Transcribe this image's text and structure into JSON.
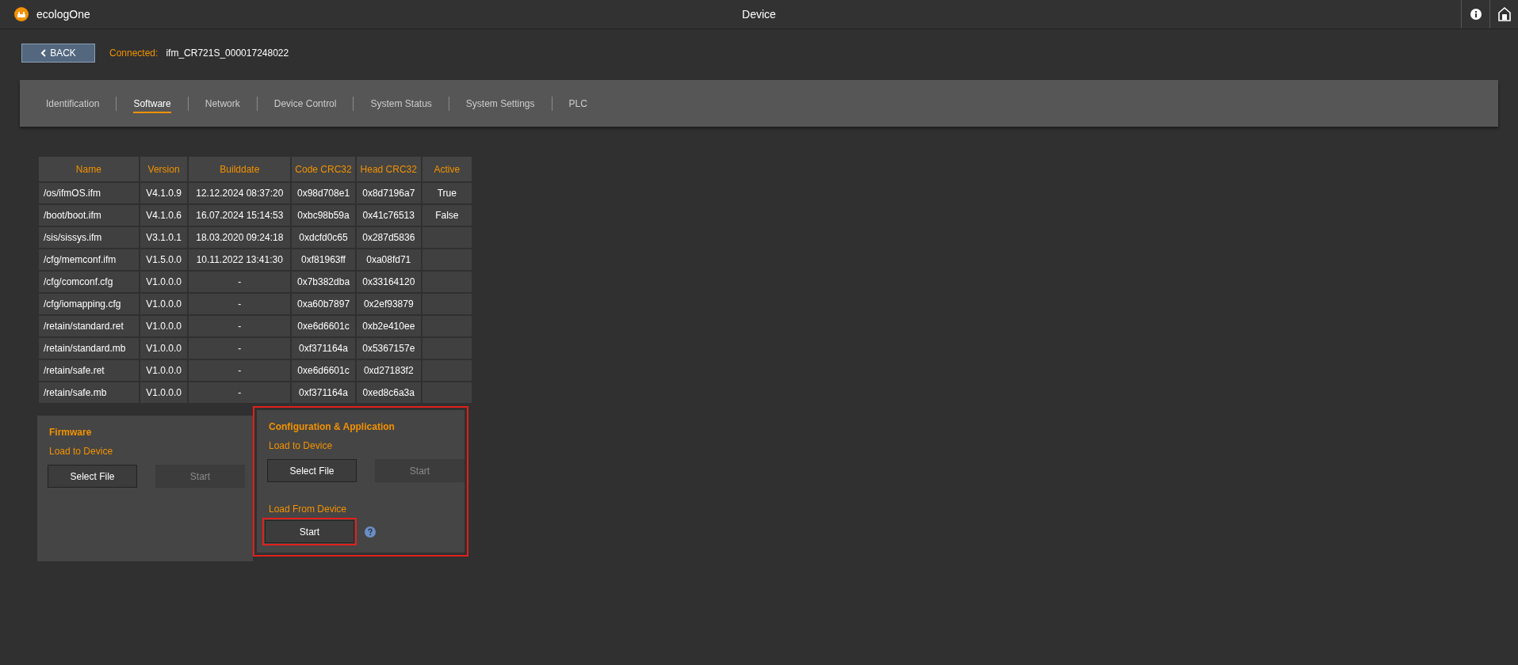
{
  "app": {
    "name": "ecologOne",
    "title": "Device"
  },
  "connection": {
    "back": "BACK",
    "label": "Connected:",
    "device": "ifm_CR721S_000017248022"
  },
  "tabs": [
    {
      "label": "Identification",
      "selected": false
    },
    {
      "label": "Software",
      "selected": true
    },
    {
      "label": "Network",
      "selected": false
    },
    {
      "label": "Device Control",
      "selected": false
    },
    {
      "label": "System Status",
      "selected": false
    },
    {
      "label": "System Settings",
      "selected": false
    },
    {
      "label": "PLC",
      "selected": false
    }
  ],
  "table": {
    "columns": [
      "Name",
      "Version",
      "Builddate",
      "Code CRC32",
      "Head CRC32",
      "Active"
    ],
    "rows": [
      [
        "/os/ifmOS.ifm",
        "V4.1.0.9",
        "12.12.2024 08:37:20",
        "0x98d708e1",
        "0x8d7196a7",
        "True"
      ],
      [
        "/boot/boot.ifm",
        "V4.1.0.6",
        "16.07.2024 15:14:53",
        "0xbc98b59a",
        "0x41c76513",
        "False"
      ],
      [
        "/sis/sissys.ifm",
        "V3.1.0.1",
        "18.03.2020 09:24:18",
        "0xdcfd0c65",
        "0x287d5836",
        ""
      ],
      [
        "/cfg/memconf.ifm",
        "V1.5.0.0",
        "10.11.2022 13:41:30",
        "0xf81963ff",
        "0xa08fd71",
        ""
      ],
      [
        "/cfg/comconf.cfg",
        "V1.0.0.0",
        "-",
        "0x7b382dba",
        "0x33164120",
        ""
      ],
      [
        "/cfg/iomapping.cfg",
        "V1.0.0.0",
        "-",
        "0xa60b7897",
        "0x2ef93879",
        ""
      ],
      [
        "/retain/standard.ret",
        "V1.0.0.0",
        "-",
        "0xe6d6601c",
        "0xb2e410ee",
        ""
      ],
      [
        "/retain/standard.mb",
        "V1.0.0.0",
        "-",
        "0xf371164a",
        "0x5367157e",
        ""
      ],
      [
        "/retain/safe.ret",
        "V1.0.0.0",
        "-",
        "0xe6d6601c",
        "0xd27183f2",
        ""
      ],
      [
        "/retain/safe.mb",
        "V1.0.0.0",
        "-",
        "0xf371164a",
        "0xed8c6a3a",
        ""
      ]
    ]
  },
  "sections": [
    {
      "title": "Firmware",
      "highlighted": false,
      "groups": [
        {
          "label": "Load to Device",
          "buttons": [
            {
              "label": "Select File",
              "disabled": false,
              "highlighted": false,
              "help": false
            },
            {
              "label": "Start",
              "disabled": true,
              "highlighted": false,
              "help": false
            }
          ]
        }
      ]
    },
    {
      "title": "Configuration & Application",
      "highlighted": true,
      "groups": [
        {
          "label": "Load to Device",
          "buttons": [
            {
              "label": "Select File",
              "disabled": false,
              "highlighted": false,
              "help": false
            },
            {
              "label": "Start",
              "disabled": true,
              "highlighted": false,
              "help": false
            }
          ]
        },
        {
          "label": "Load From Device",
          "buttons": [
            {
              "label": "Start",
              "disabled": false,
              "highlighted": true,
              "help": true
            }
          ]
        }
      ]
    }
  ]
}
